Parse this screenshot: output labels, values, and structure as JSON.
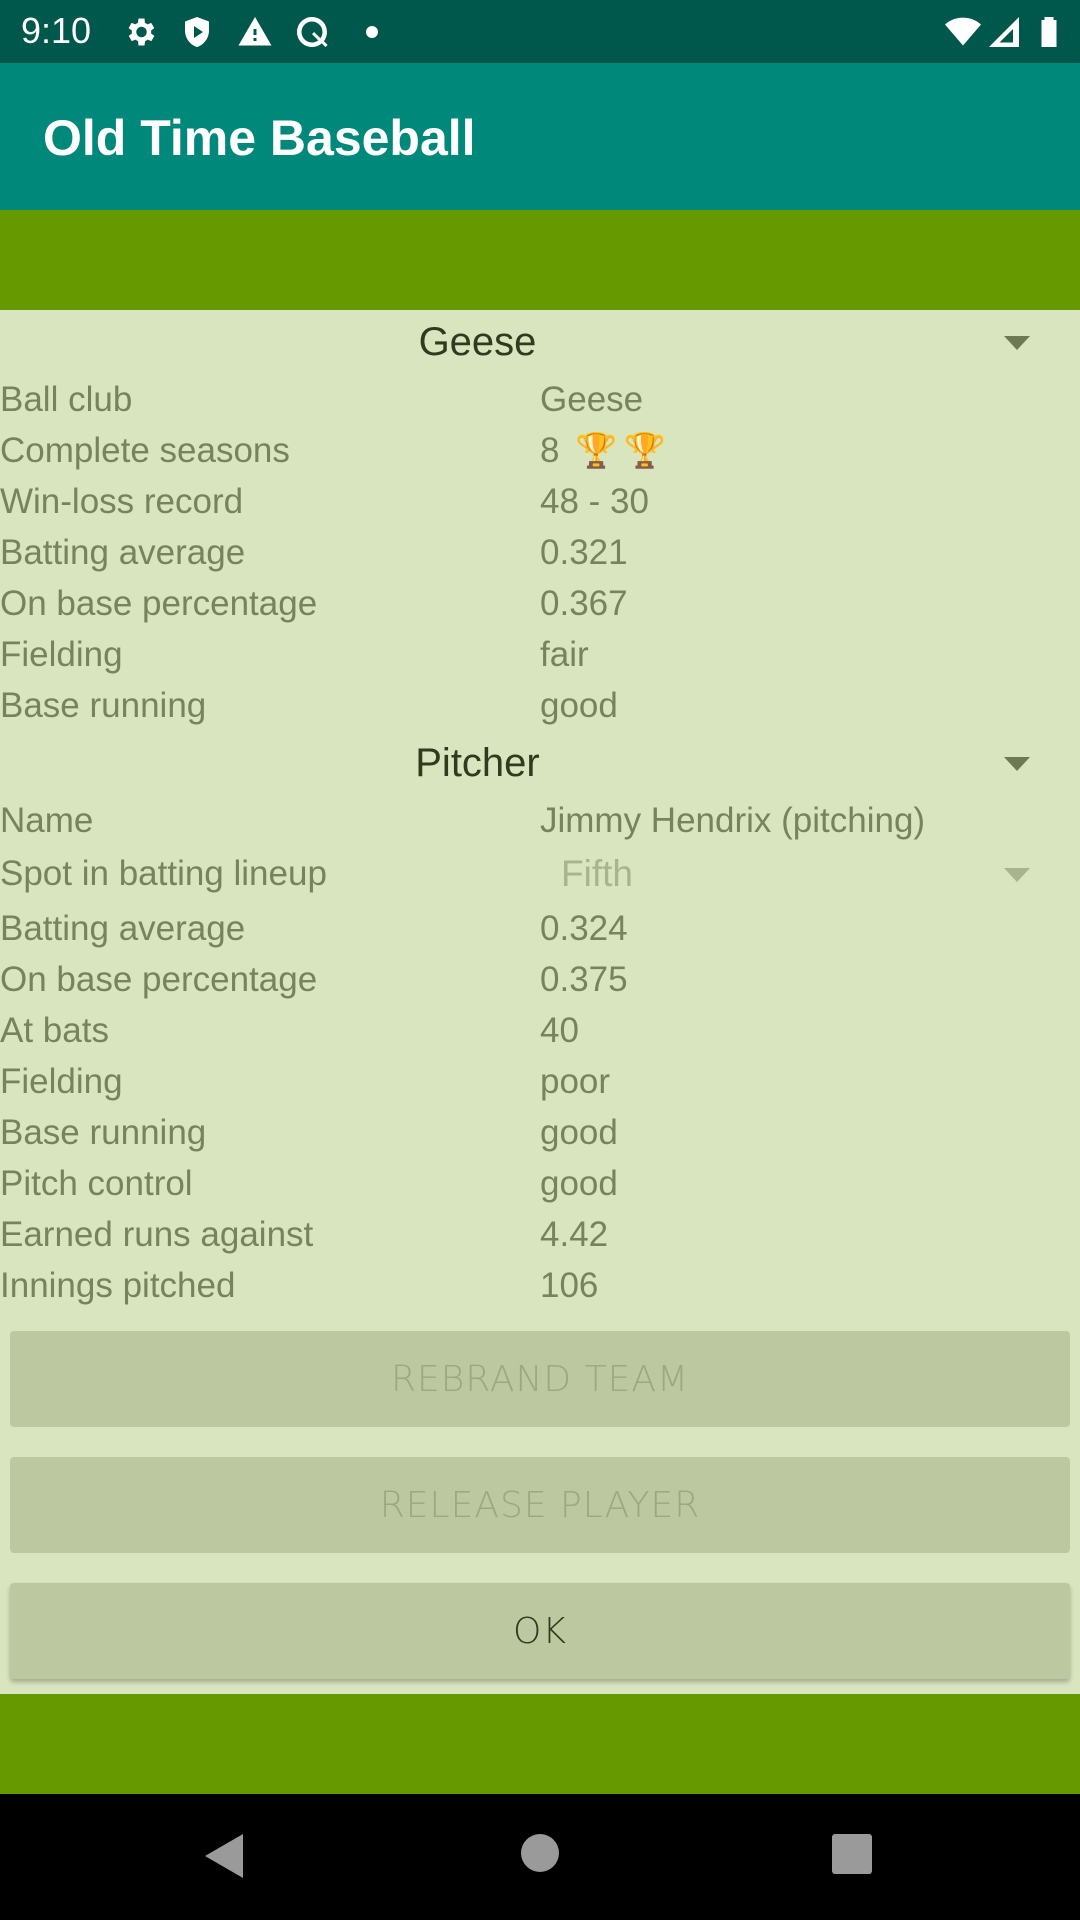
{
  "status_bar": {
    "time": "9:10",
    "left_icons": [
      "gear-icon",
      "shield-play-icon",
      "warning-icon",
      "q-logo-icon",
      "dot-icon"
    ],
    "right_icons": [
      "wifi-icon",
      "signal-icon",
      "battery-icon"
    ]
  },
  "app_bar": {
    "title": "Old Time Baseball"
  },
  "team_section": {
    "spinner_value": "Geese",
    "rows": [
      {
        "label": "Ball club",
        "value": "Geese"
      },
      {
        "label": "Complete seasons",
        "value": "8",
        "trophies": 2
      },
      {
        "label": "Win-loss record",
        "value": "48 - 30"
      },
      {
        "label": "Batting average",
        "value": "0.321"
      },
      {
        "label": "On base percentage",
        "value": "0.367"
      },
      {
        "label": "Fielding",
        "value": "fair"
      },
      {
        "label": "Base running",
        "value": "good"
      }
    ]
  },
  "player_section": {
    "spinner_value": "Pitcher",
    "name_row": {
      "label": "Name",
      "value": "Jimmy Hendrix (pitching)"
    },
    "lineup_row": {
      "label": "Spot in batting lineup",
      "value": "Fifth"
    },
    "rows": [
      {
        "label": "Batting average",
        "value": "0.324"
      },
      {
        "label": "On base percentage",
        "value": "0.375"
      },
      {
        "label": "At bats",
        "value": "40"
      },
      {
        "label": "Fielding",
        "value": "poor"
      },
      {
        "label": "Base running",
        "value": "good"
      },
      {
        "label": "Pitch control",
        "value": "good"
      },
      {
        "label": "Earned runs against",
        "value": "4.42"
      },
      {
        "label": "Innings pitched",
        "value": "106"
      }
    ]
  },
  "buttons": {
    "rebrand": {
      "label": "REBRAND TEAM",
      "enabled": false
    },
    "release": {
      "label": "RELEASE PLAYER",
      "enabled": false
    },
    "ok": {
      "label": "OK",
      "enabled": true
    }
  },
  "trophy_glyph": "🏆",
  "nav_bar": {
    "icons": [
      "back-icon",
      "home-icon",
      "recents-icon"
    ]
  }
}
